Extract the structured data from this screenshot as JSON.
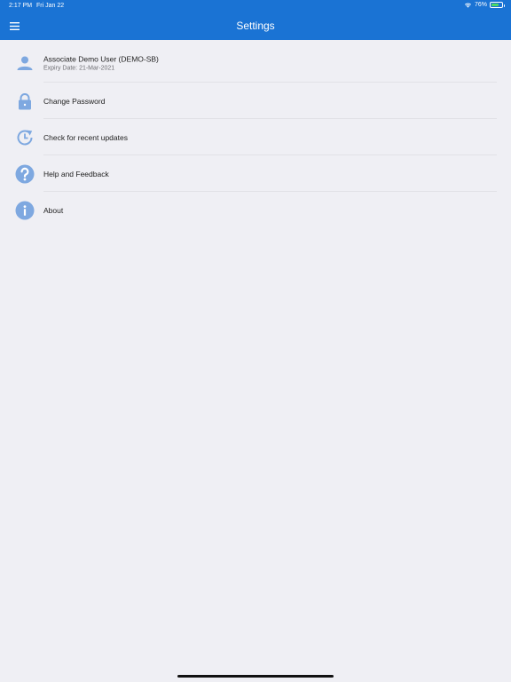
{
  "status_bar": {
    "time": "2:17 PM",
    "date": "Fri Jan 22",
    "battery_text": "76%",
    "battery_level": 0.76
  },
  "header": {
    "title": "Settings"
  },
  "settings": {
    "items": [
      {
        "label": "Associate Demo User (DEMO-SB)",
        "sublabel": "Expiry Date: 21-Mar-2021",
        "icon": "user-icon"
      },
      {
        "label": "Change Password",
        "icon": "lock-icon"
      },
      {
        "label": "Check for recent updates",
        "icon": "refresh-icon"
      },
      {
        "label": "Help and Feedback",
        "icon": "help-icon"
      },
      {
        "label": "About",
        "icon": "info-icon"
      }
    ]
  },
  "colors": {
    "header_bg": "#1a73d4",
    "icon": "#7ea8e0",
    "page_bg": "#efeff4"
  }
}
